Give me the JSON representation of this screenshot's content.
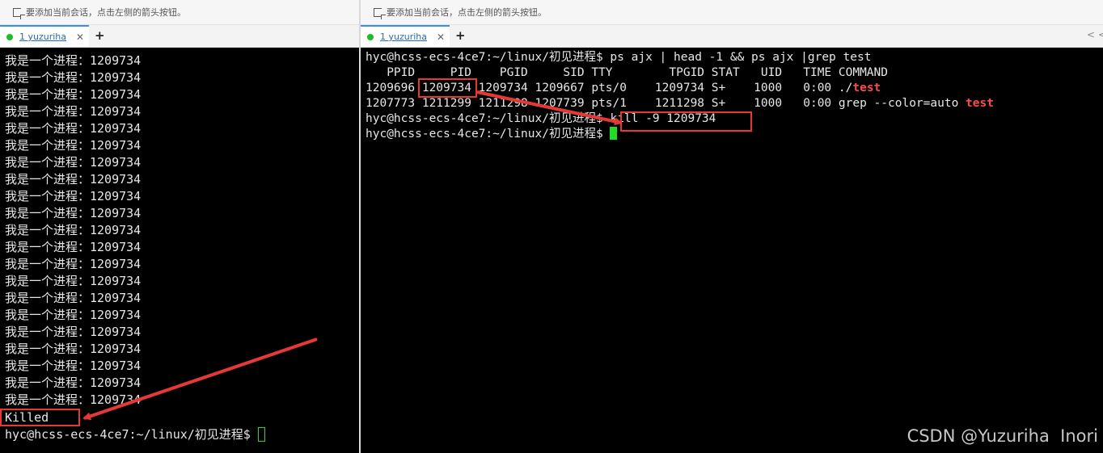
{
  "left": {
    "hint": "要添加当前会话，点击左侧的箭头按钮。",
    "tab_label": "1 yuzuriha",
    "tab_close": "✕",
    "tab_add": "+",
    "lines": [
      "我是一个进程：1209734",
      "我是一个进程：1209734",
      "我是一个进程：1209734",
      "我是一个进程：1209734",
      "我是一个进程：1209734",
      "我是一个进程：1209734",
      "我是一个进程：1209734",
      "我是一个进程：1209734",
      "我是一个进程：1209734",
      "我是一个进程：1209734",
      "我是一个进程：1209734",
      "我是一个进程：1209734",
      "我是一个进程：1209734",
      "我是一个进程：1209734",
      "我是一个进程：1209734",
      "我是一个进程：1209734",
      "我是一个进程：1209734",
      "我是一个进程：1209734",
      "我是一个进程：1209734",
      "我是一个进程：1209734",
      "我是一个进程：1209734"
    ],
    "killed": "Killed",
    "prompt": "hyc@hcss-ecs-4ce7:~/linux/初见进程$ "
  },
  "right": {
    "hint": "要添加当前会话，点击左侧的箭头按钮。",
    "tab_label": "1 yuzuriha",
    "tab_close": "✕",
    "tab_add": "+",
    "nav_prev": "<",
    "nav_next": "<",
    "cmd_line": "hyc@hcss-ecs-4ce7:~/linux/初见进程$ ps ajx | head -1 && ps ajx |grep test",
    "header_line": "   PPID     PID    PGID     SID TTY        TPGID STAT   UID   TIME COMMAND",
    "row1_prefix": "1209696 1209734 1209734 1209667 pts/0    1209734 S+    1000   0:00 ./",
    "row1_red": "test",
    "row2_prefix": "1207773 1211299 1211298 1207739 pts/1    1211298 S+    1000   0:00 grep --color=auto ",
    "row2_red": "test",
    "prompt": "hyc@hcss-ecs-4ce7:~/linux/初见进程$ ",
    "kill_cmd": "kill -9 1209734"
  },
  "watermark": "CSDN @Yuzuriha  Inori",
  "colors": {
    "highlight": "#e53935",
    "cursor": "#22dd22",
    "tab_accent": "#3a8ee6",
    "grep_match": "#ff4a4a"
  }
}
